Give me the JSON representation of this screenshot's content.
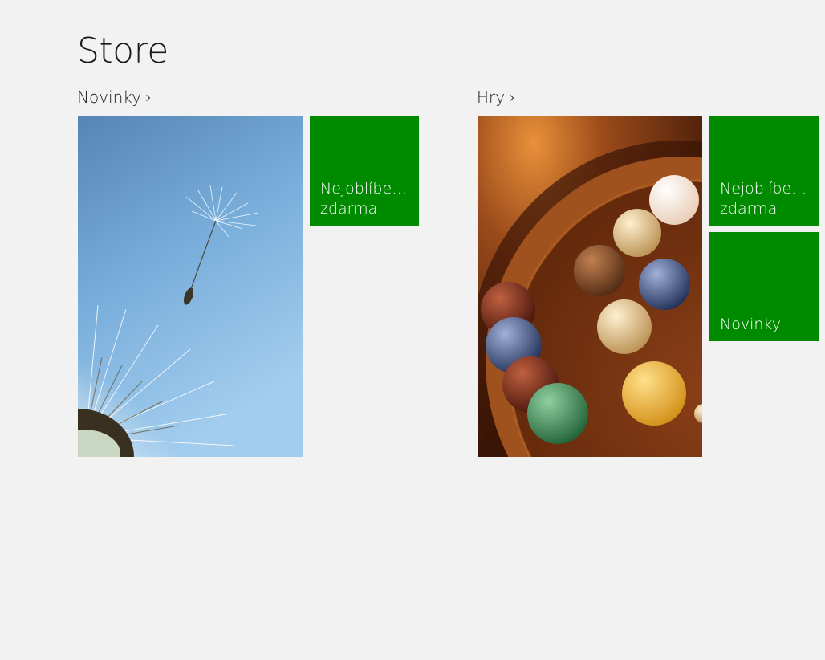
{
  "page": {
    "title": "Store"
  },
  "groups": [
    {
      "header": "Novinky",
      "hero_image": "dandelion-seed-photo",
      "tiles": [
        {
          "line1": "Nejoblíbe…",
          "line2": "zdarma",
          "color": "#008a00"
        }
      ]
    },
    {
      "header": "Hry",
      "hero_image": "marbles-solitaire-photo",
      "tiles": [
        {
          "line1": "Nejoblíbe…",
          "line2": "zdarma",
          "color": "#008a00"
        },
        {
          "line1": "",
          "line2": "Novinky",
          "color": "#008a00"
        }
      ]
    }
  ],
  "icons": {
    "group_chevron": "chevron-right-icon"
  },
  "colors": {
    "background": "#f2f2f2",
    "tile_green": "#008a00",
    "sky_top": "#4a7fb0",
    "sky_bottom": "#9cc8ec"
  }
}
